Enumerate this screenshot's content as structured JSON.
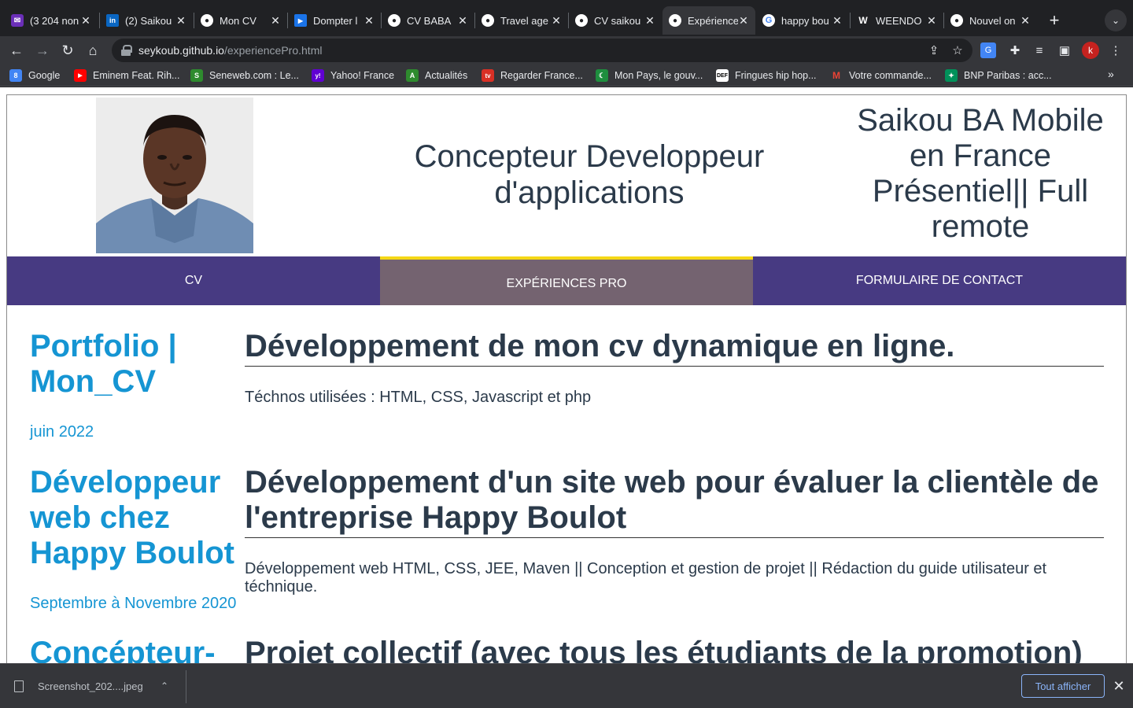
{
  "browser": {
    "tabs": [
      {
        "title": "(3 204 non",
        "favicon": "mail-icon",
        "fav_color": "#6b2fb8",
        "active": false
      },
      {
        "title": "(2) Saikou",
        "favicon": "linkedin-icon",
        "fav_color": "#0a66c2",
        "active": false
      },
      {
        "title": "Mon CV",
        "favicon": "github-icon",
        "fav_color": "#ffffff",
        "active": false
      },
      {
        "title": "Dompter l",
        "favicon": "video-icon",
        "fav_color": "#1a73e8",
        "active": false
      },
      {
        "title": "CV BABA",
        "favicon": "github-icon",
        "fav_color": "#ffffff",
        "active": false
      },
      {
        "title": "Travel age",
        "favicon": "github-icon",
        "fav_color": "#ffffff",
        "active": false
      },
      {
        "title": "CV saikou",
        "favicon": "github-icon",
        "fav_color": "#ffffff",
        "active": false
      },
      {
        "title": "Expérience",
        "favicon": "github-icon",
        "fav_color": "#ffffff",
        "active": true
      },
      {
        "title": "happy bou",
        "favicon": "google-icon",
        "fav_color": "#ffffff",
        "active": false
      },
      {
        "title": "WEENDO",
        "favicon": "w-icon",
        "fav_color": "#ffffff",
        "active": false
      },
      {
        "title": "Nouvel on",
        "favicon": "chrome-icon",
        "fav_color": "#ffffff",
        "active": false
      }
    ],
    "url_host": "seykoub.github.io",
    "url_path": "/experiencePro.html",
    "profile_initial": "k",
    "bookmarks": [
      {
        "label": "Google",
        "fav_color": "#4285f4",
        "glyph": "8"
      },
      {
        "label": "Eminem Feat. Rih...",
        "fav_color": "#ff0000",
        "glyph": "▶"
      },
      {
        "label": "Seneweb.com : Le...",
        "fav_color": "#2e8b2e",
        "glyph": "S"
      },
      {
        "label": "Yahoo! France",
        "fav_color": "#6001d2",
        "glyph": "y!"
      },
      {
        "label": "Actualités",
        "fav_color": "#2e8b2e",
        "glyph": "A"
      },
      {
        "label": "Regarder France...",
        "fav_color": "#d93025",
        "glyph": "tv"
      },
      {
        "label": "Mon Pays, le gouv...",
        "fav_color": "#1e8e3e",
        "glyph": "☾"
      },
      {
        "label": "Fringues hip hop...",
        "fav_color": "#ffffff",
        "glyph": "DEF"
      },
      {
        "label": "Votre commande...",
        "fav_color": "#ea4335",
        "glyph": "M"
      },
      {
        "label": "BNP Paribas : acc...",
        "fav_color": "#00915a",
        "glyph": "✦"
      }
    ]
  },
  "page": {
    "header_center": "Concepteur Developpeur d'applications",
    "header_right": "Saikou BA Mobile en France Présentiel|| Full remote",
    "nav": [
      {
        "label": "CV",
        "active": false
      },
      {
        "label": "Expériences Pro",
        "active": true
      },
      {
        "label": "Formulaire de contact",
        "active": false
      }
    ],
    "experiences": [
      {
        "left_title": "Portfolio | Mon_CV",
        "date": "juin 2022",
        "title": "Développement de mon cv dynamique en ligne.",
        "description": "Téchnos utilisées : HTML, CSS, Javascript et php"
      },
      {
        "left_title": "Développeur web chez Happy Boulot",
        "date": "Septembre à Novembre 2020",
        "title": "Développement d'un site web pour évaluer la clientèle de l'entreprise Happy Boulot",
        "description": "Développement web HTML, CSS, JEE, Maven || Conception et gestion de projet || Rédaction du guide utilisateur et téchnique."
      },
      {
        "left_title": "Concépteur-",
        "date": "",
        "title": "Projet collectif (avec tous les étudiants de la promotion)",
        "description": ""
      }
    ]
  },
  "downloads": {
    "file_name": "Screenshot_202....jpeg",
    "show_all": "Tout afficher"
  }
}
